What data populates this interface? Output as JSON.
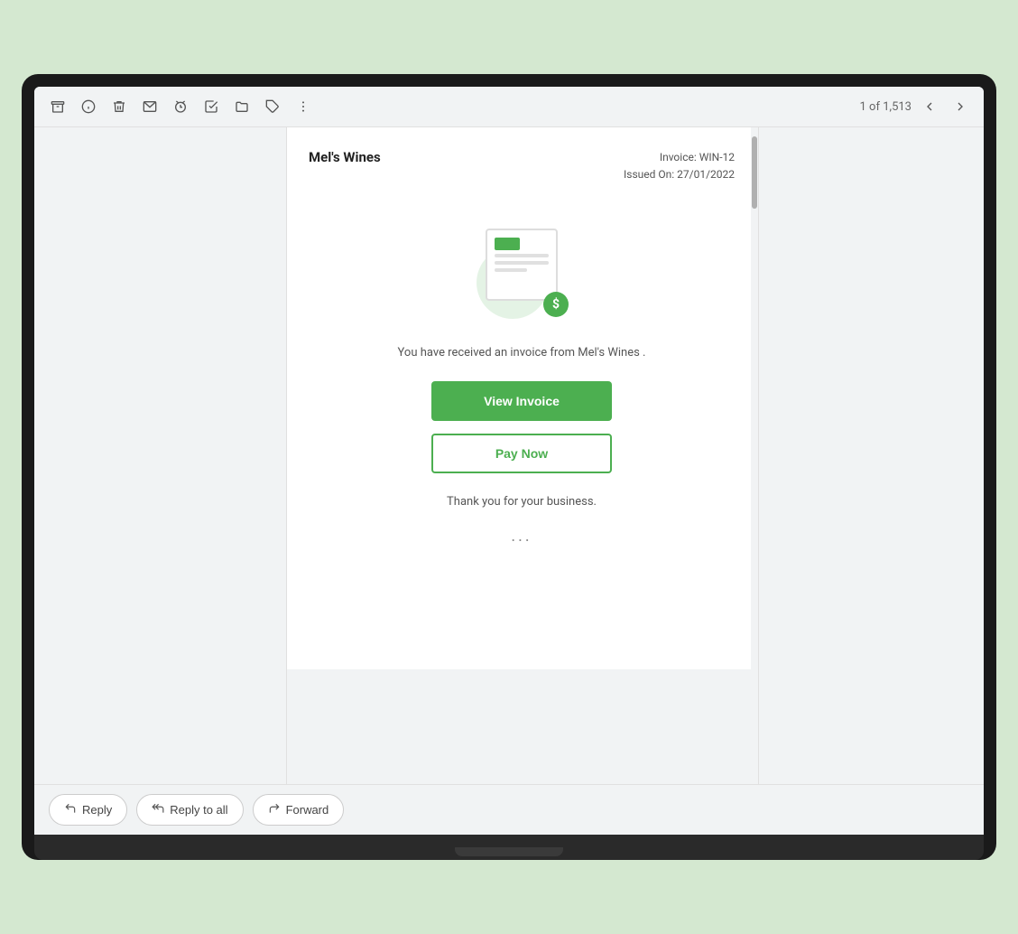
{
  "toolbar": {
    "archive_icon": "⬜",
    "info_icon": "ℹ",
    "delete_icon": "🗑",
    "email_icon": "✉",
    "snooze_icon": "⏰",
    "task_icon": "✔",
    "folder_icon": "📁",
    "label_icon": "🏷",
    "more_icon": "⋮",
    "pagination_text": "1 of 1,513",
    "prev_icon": "‹",
    "next_icon": "›"
  },
  "email": {
    "company_name": "Mel's Wines",
    "invoice_label": "Invoice: WIN-12",
    "issued_on": "Issued On: 27/01/2022",
    "body_text": "You have received an invoice from Mel's Wines .",
    "view_invoice_btn": "View Invoice",
    "pay_now_btn": "Pay Now",
    "thank_you_text": "Thank you for your business.",
    "ellipsis": "..."
  },
  "reply_bar": {
    "reply_label": "Reply",
    "reply_all_label": "Reply to all",
    "forward_label": "Forward"
  }
}
